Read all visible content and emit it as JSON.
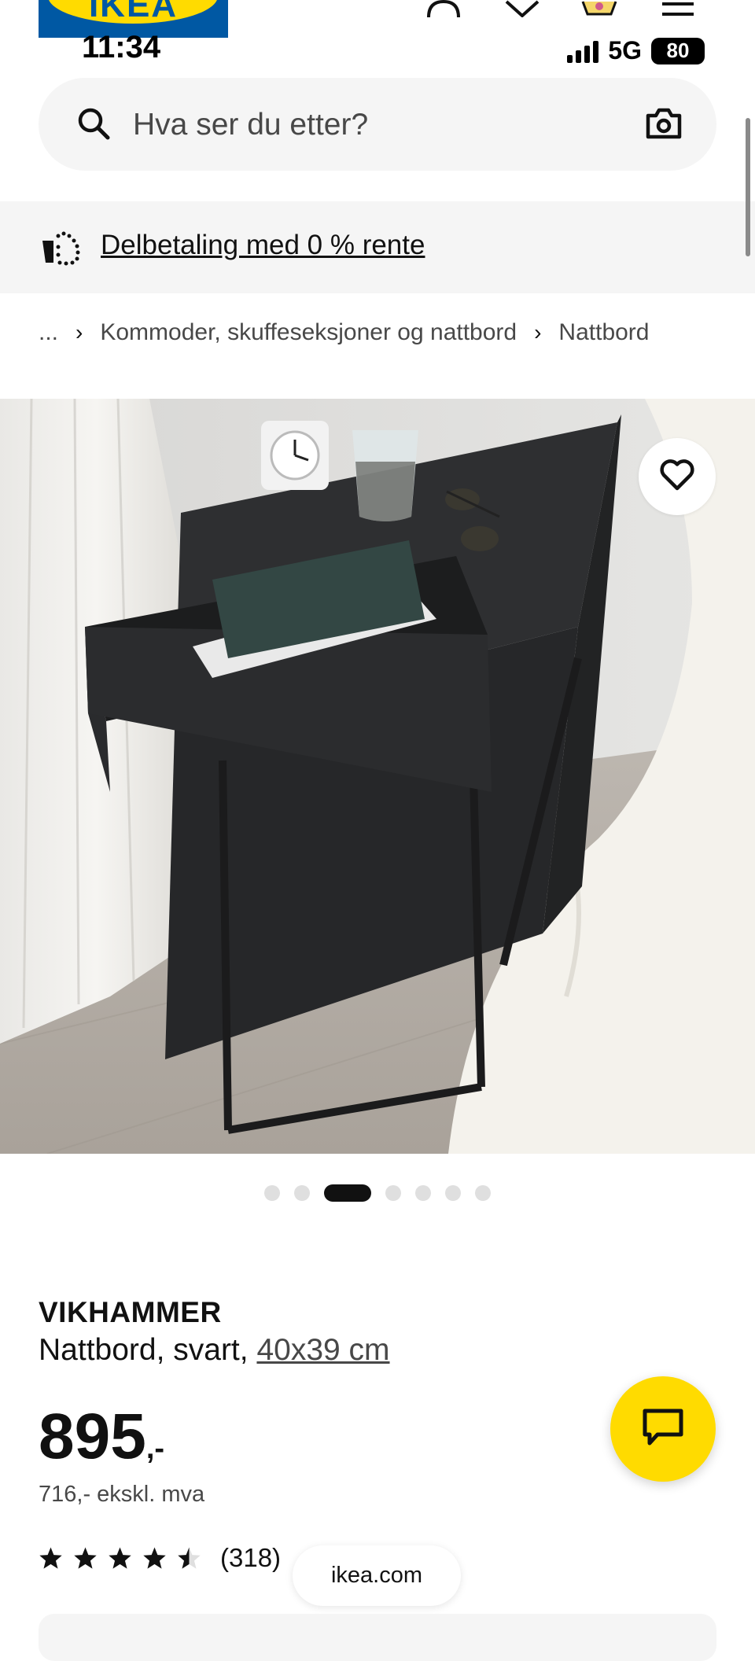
{
  "status_bar": {
    "time": "11:34",
    "network": "5G",
    "battery": "80"
  },
  "logo": {
    "text": "IKEA"
  },
  "search": {
    "placeholder": "Hva ser du etter?"
  },
  "promo": {
    "link": "Delbetaling med 0 % rente"
  },
  "breadcrumb": {
    "ellipsis": "...",
    "items": [
      "Kommoder, skuffeseksjoner og nattbord",
      "Nattbord"
    ]
  },
  "gallery": {
    "image_count": 7,
    "active_index": 2
  },
  "product": {
    "name": "VIKHAMMER",
    "description": "Nattbord, svart, ",
    "size": "40x39 cm",
    "price": "895",
    "price_suffix": ",-",
    "price_ex_vat": "716,- ekskl. mva",
    "rating": 4.5,
    "rating_count": "(318)"
  },
  "browser": {
    "domain": "ikea.com"
  },
  "colors": {
    "ikea_blue": "#0058a3",
    "ikea_yellow": "#ffdb00",
    "surface_grey": "#f5f5f5"
  },
  "icons": [
    "profile-icon",
    "heart-icon",
    "cart-icon",
    "menu-icon",
    "search-icon",
    "camera-icon",
    "installment-icon",
    "favorite-heart-icon",
    "star-icon",
    "chat-icon"
  ]
}
